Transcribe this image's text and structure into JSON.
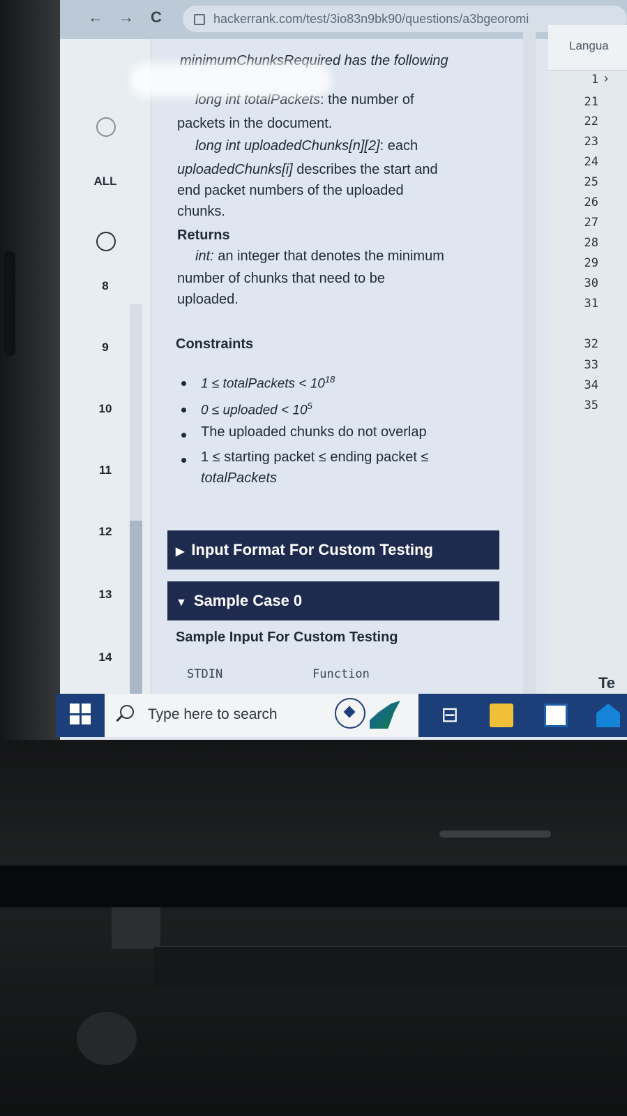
{
  "browser": {
    "back": "←",
    "forward": "→",
    "reload": "C",
    "url": "hackerrank.com/test/3io83n9bk90/questions/a3bgeoromi"
  },
  "rail": {
    "all_label": "ALL",
    "question_numbers": [
      "8",
      "9",
      "10",
      "11",
      "12",
      "13",
      "14"
    ]
  },
  "content": {
    "intro": "minimumChunksRequired has the following",
    "param1_type": "long int",
    "param1_name": "totalPackets",
    "param1_desc": ": the number of",
    "param1_desc2": "packets in the document.",
    "param2_sig": "long int uploadedChunks[n][2]",
    "param2_desc": ": each",
    "param2_name2": "uploadedChunks[i]",
    "param2_desc2": " describes the start and",
    "param2_desc3": "end packet numbers of the uploaded",
    "param2_desc4": "chunks.",
    "returns_heading": "Returns",
    "returns_type": "int:",
    "returns_desc": " an integer that denotes the minimum",
    "returns_desc2": "number of chunks that need to be",
    "returns_desc3": "uploaded.",
    "constraints_heading": "Constraints",
    "constraint1": "1 ≤ totalPackets < 10",
    "constraint1_exp": "18",
    "constraint2": "0 ≤ uploaded < 10",
    "constraint2_exp": "5",
    "constraint3": "The uploaded chunks do not overlap",
    "constraint4_a": "1 ≤ starting packet ≤ ending packet ≤",
    "constraint4_b": "totalPackets",
    "input_format_label": "Input Format For Custom Testing",
    "sample_case_label": "Sample Case 0",
    "sample_input_heading": "Sample Input For Custom Testing",
    "stdin_label": "STDIN",
    "function_label": "Function"
  },
  "editor": {
    "language_label": "Langua",
    "first_line": "1",
    "line_numbers": [
      "21",
      "22",
      "23",
      "24",
      "25",
      "26",
      "27",
      "28",
      "29",
      "30",
      "31",
      "32",
      "33",
      "34",
      "35"
    ],
    "bottom_text": "Te"
  },
  "taskbar": {
    "search_placeholder": "Type here to search"
  },
  "colors": {
    "section_bar": "#1e2b4f",
    "taskbar": "#1c3f7a"
  }
}
